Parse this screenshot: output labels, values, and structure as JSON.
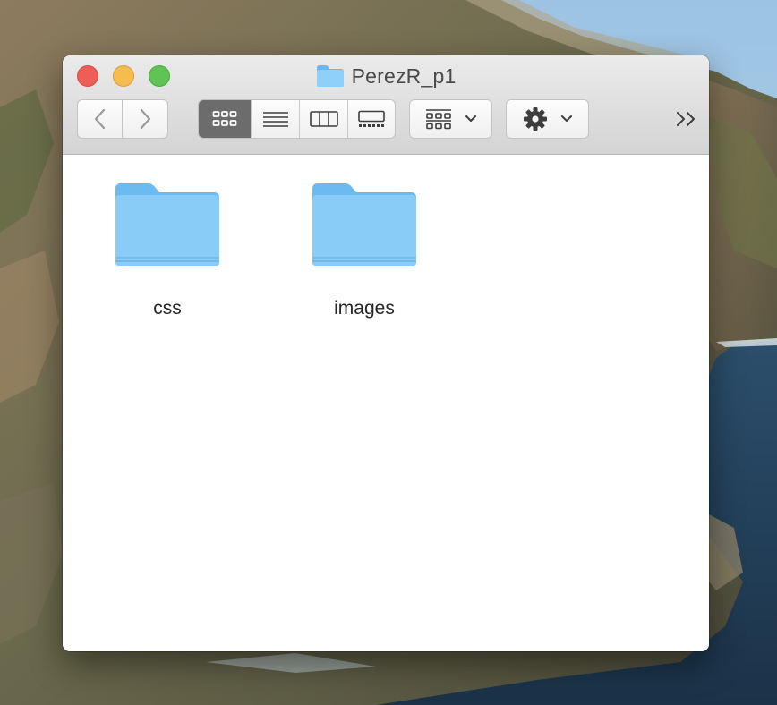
{
  "window": {
    "title": "PerezR_p1",
    "title_icon": "folder-icon"
  },
  "toolbar": {
    "back_icon": "chevron-left-icon",
    "forward_icon": "chevron-right-icon",
    "views": [
      {
        "icon": "icon-view-icon",
        "active": true
      },
      {
        "icon": "list-view-icon",
        "active": false
      },
      {
        "icon": "column-view-icon",
        "active": false
      },
      {
        "icon": "gallery-view-icon",
        "active": false
      }
    ],
    "group_icon": "group-by-icon",
    "action_icon": "gear-icon",
    "overflow_icon": "double-chevron-right-icon"
  },
  "files": [
    {
      "name": "css",
      "icon": "folder-icon"
    },
    {
      "name": "images",
      "icon": "folder-icon"
    }
  ],
  "colors": {
    "folder": "#7cc6f5",
    "selected_view": "#6c6c6c",
    "close": "#ee5e56",
    "minimize": "#f5bd4f",
    "zoom": "#5fc454"
  }
}
